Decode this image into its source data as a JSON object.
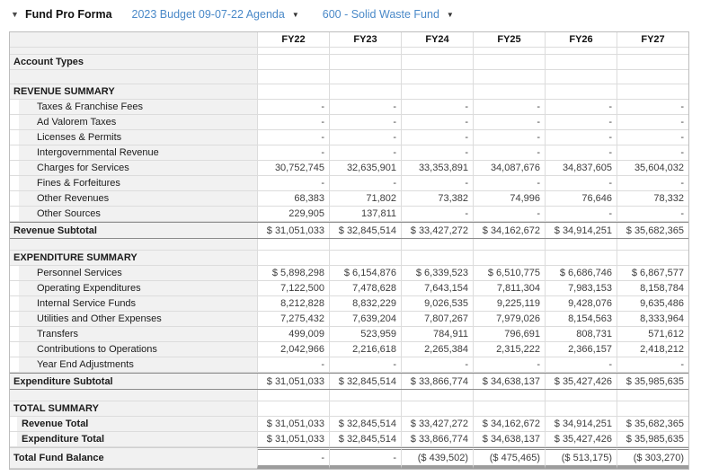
{
  "header": {
    "title": "Fund Pro Forma",
    "collapse_icon": "caret-down",
    "budget_dropdown_label": "2023 Budget 09-07-22 Agenda",
    "fund_dropdown_label": "600 - Solid Waste Fund"
  },
  "colors": {
    "link_blue": "#4a89c8",
    "label_column_bg": "#f1f1f1",
    "grid_line": "#dcdcdc",
    "subtotal_rule": "#8c8c8c"
  },
  "table": {
    "columns": [
      "FY22",
      "FY23",
      "FY24",
      "FY25",
      "FY26",
      "FY27"
    ],
    "rows": [
      {
        "type": "spacer-sm"
      },
      {
        "type": "account",
        "label": "Account Types"
      },
      {
        "type": "spacer-lg"
      },
      {
        "type": "section",
        "label": "REVENUE SUMMARY"
      },
      {
        "type": "item",
        "label": "Taxes & Franchise Fees",
        "values": [
          "-",
          "-",
          "-",
          "-",
          "-",
          "-"
        ]
      },
      {
        "type": "item",
        "label": "Ad Valorem Taxes",
        "values": [
          "-",
          "-",
          "-",
          "-",
          "-",
          "-"
        ]
      },
      {
        "type": "item",
        "label": "Licenses & Permits",
        "values": [
          "-",
          "-",
          "-",
          "-",
          "-",
          "-"
        ]
      },
      {
        "type": "item",
        "label": "Intergovernmental Revenue",
        "values": [
          "-",
          "-",
          "-",
          "-",
          "-",
          "-"
        ]
      },
      {
        "type": "item",
        "label": "Charges for Services",
        "values": [
          "30,752,745",
          "32,635,901",
          "33,353,891",
          "34,087,676",
          "34,837,605",
          "35,604,032"
        ]
      },
      {
        "type": "item",
        "label": "Fines & Forfeitures",
        "values": [
          "-",
          "-",
          "-",
          "-",
          "-",
          "-"
        ]
      },
      {
        "type": "item",
        "label": "Other Revenues",
        "values": [
          "68,383",
          "71,802",
          "73,382",
          "74,996",
          "76,646",
          "78,332"
        ]
      },
      {
        "type": "item",
        "label": "Other Sources",
        "values": [
          "229,905",
          "137,811",
          "-",
          "-",
          "-",
          "-"
        ]
      },
      {
        "type": "subtotal",
        "label": "Revenue Subtotal",
        "values": [
          "$ 31,051,033",
          "$ 32,845,514",
          "$ 33,427,272",
          "$ 34,162,672",
          "$ 34,914,251",
          "$ 35,682,365"
        ]
      },
      {
        "type": "spacer-md"
      },
      {
        "type": "section",
        "label": "EXPENDITURE SUMMARY"
      },
      {
        "type": "item",
        "label": "Personnel Services",
        "values": [
          "$ 5,898,298",
          "$ 6,154,876",
          "$ 6,339,523",
          "$ 6,510,775",
          "$ 6,686,746",
          "$ 6,867,577"
        ]
      },
      {
        "type": "item",
        "label": "Operating Expenditures",
        "values": [
          "7,122,500",
          "7,478,628",
          "7,643,154",
          "7,811,304",
          "7,983,153",
          "8,158,784"
        ]
      },
      {
        "type": "item",
        "label": "Internal Service Funds",
        "values": [
          "8,212,828",
          "8,832,229",
          "9,026,535",
          "9,225,119",
          "9,428,076",
          "9,635,486"
        ]
      },
      {
        "type": "item",
        "label": "Utilities and Other Expenses",
        "values": [
          "7,275,432",
          "7,639,204",
          "7,807,267",
          "7,979,026",
          "8,154,563",
          "8,333,964"
        ]
      },
      {
        "type": "item",
        "label": "Transfers",
        "values": [
          "499,009",
          "523,959",
          "784,911",
          "796,691",
          "808,731",
          "571,612"
        ]
      },
      {
        "type": "item",
        "label": "Contributions to Operations",
        "values": [
          "2,042,966",
          "2,216,618",
          "2,265,384",
          "2,315,222",
          "2,366,157",
          "2,418,212"
        ]
      },
      {
        "type": "item",
        "label": "Year End Adjustments",
        "values": [
          "-",
          "-",
          "-",
          "-",
          "-",
          "-"
        ]
      },
      {
        "type": "subtotal",
        "label": "Expenditure Subtotal",
        "values": [
          "$ 31,051,033",
          "$ 32,845,514",
          "$ 33,866,774",
          "$ 34,638,137",
          "$ 35,427,426",
          "$ 35,985,635"
        ]
      },
      {
        "type": "spacer-md"
      },
      {
        "type": "section",
        "label": "TOTAL SUMMARY"
      },
      {
        "type": "totalitem",
        "label": "Revenue Total",
        "values": [
          "$ 31,051,033",
          "$ 32,845,514",
          "$ 33,427,272",
          "$ 34,162,672",
          "$ 34,914,251",
          "$ 35,682,365"
        ]
      },
      {
        "type": "totalitem",
        "label": "Expenditure Total",
        "values": [
          "$ 31,051,033",
          "$ 32,845,514",
          "$ 33,866,774",
          "$ 34,638,137",
          "$ 35,427,426",
          "$ 35,985,635"
        ]
      },
      {
        "type": "grandtotal",
        "label": "Total Fund Balance",
        "values": [
          "-",
          "-",
          "($ 439,502)",
          "($ 475,465)",
          "($ 513,175)",
          "($ 303,270)"
        ]
      }
    ]
  }
}
